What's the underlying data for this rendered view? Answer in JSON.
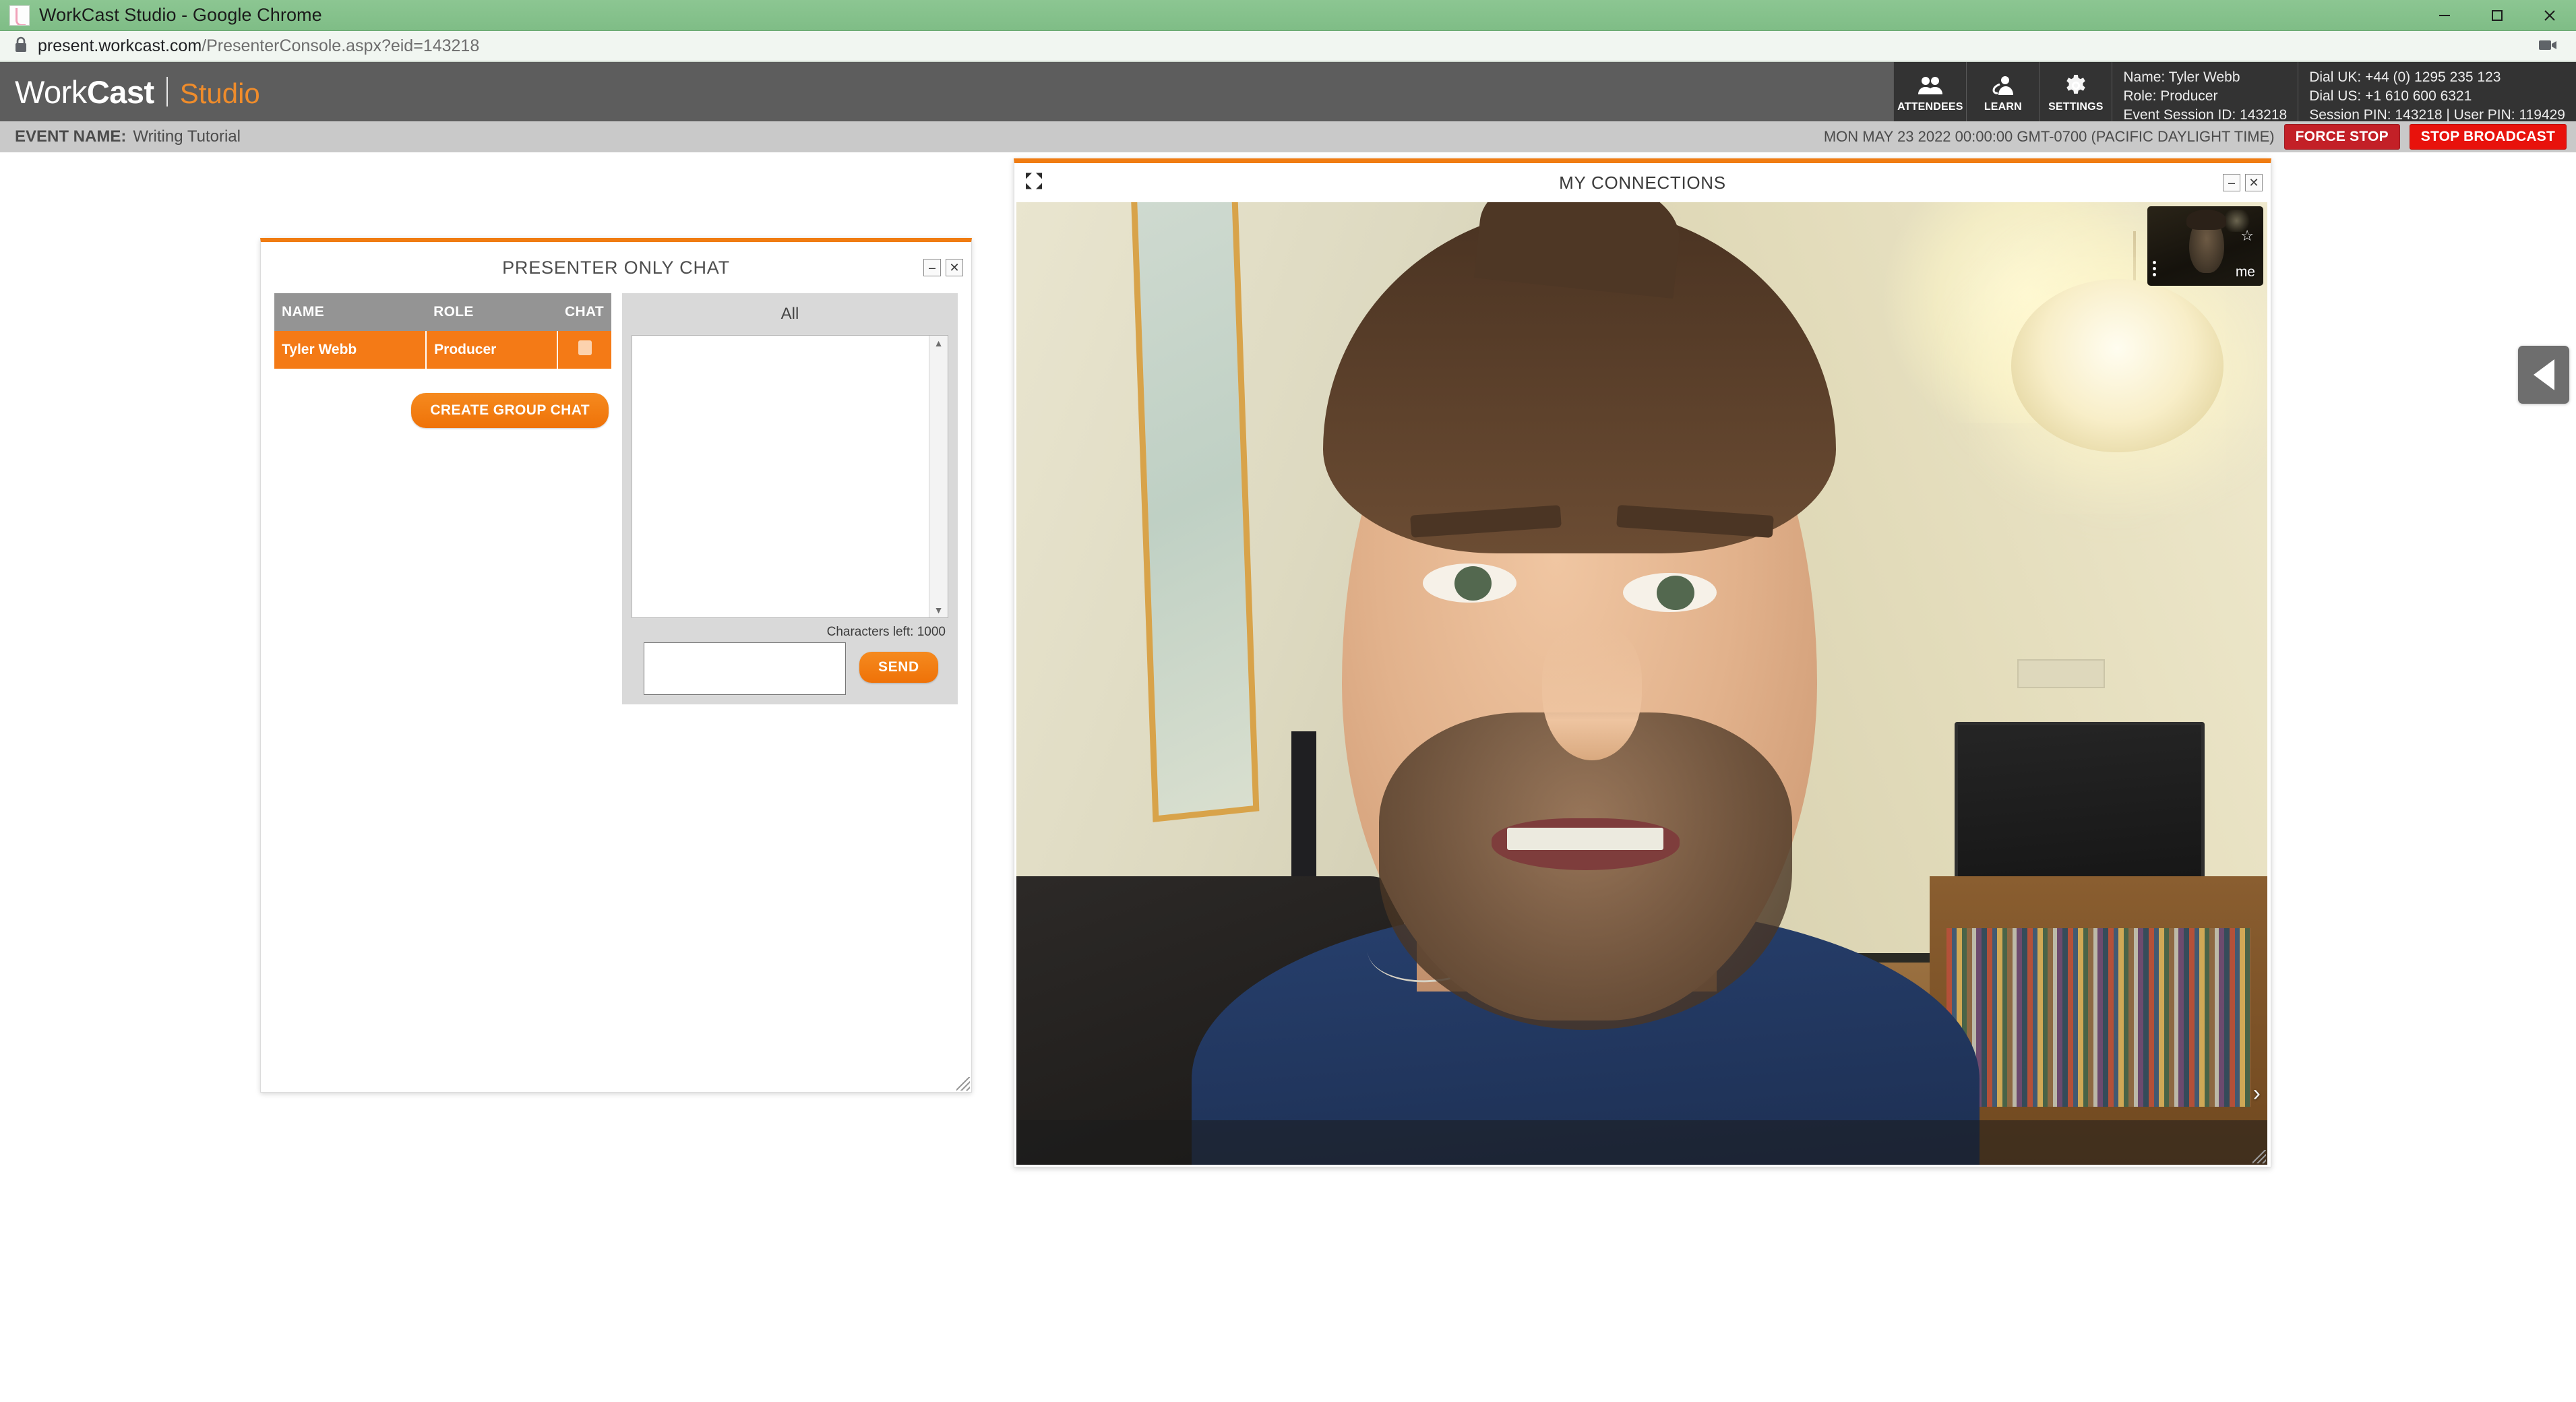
{
  "os_window": {
    "title": "WorkCast Studio - Google Chrome",
    "minimize_label": "Minimize",
    "maximize_label": "Maximize",
    "close_label": "Close"
  },
  "browser": {
    "url_secure": "present.workcast.com",
    "url_path": "/PresenterConsole.aspx?eid=143218",
    "lock_icon": "lock-icon",
    "recording_icon": "camera-recording-icon"
  },
  "app_header": {
    "brand_work": "Work",
    "brand_cast": "Cast",
    "brand_studio": "Studio",
    "nav": [
      {
        "label": "ATTENDEES",
        "icon": "attendees-icon"
      },
      {
        "label": "LEARN",
        "icon": "learn-icon"
      },
      {
        "label": "SETTINGS",
        "icon": "gear-icon"
      }
    ],
    "user_info": [
      "Name: Tyler Webb",
      "Role: Producer",
      "Event Session ID: 143218"
    ],
    "dial_info": [
      "Dial UK: +44 (0) 1295 235 123",
      "Dial US: +1 610 600 6321",
      "Session PIN: 143218 | User PIN: 119429"
    ]
  },
  "event_bar": {
    "label": "EVENT NAME:",
    "name": "Writing Tutorial",
    "datetime": "MON MAY 23 2022 00:00:00 GMT-0700 (PACIFIC DAYLIGHT TIME)",
    "force_stop_label": "FORCE STOP",
    "stop_broadcast_label": "STOP BROADCAST"
  },
  "presenter_chat": {
    "title": "PRESENTER ONLY CHAT",
    "minimize_label": "–",
    "close_label": "✕",
    "table": {
      "headers": [
        "NAME",
        "ROLE",
        "CHAT"
      ],
      "rows": [
        {
          "name": "Tyler Webb",
          "role": "Producer",
          "chat_icon": "chat-bubble-icon"
        }
      ]
    },
    "create_group_chat_label": "CREATE GROUP CHAT",
    "tab_label": "All",
    "messages": [],
    "characters_left": "Characters left: 1000",
    "input_value": "",
    "input_placeholder": "",
    "send_label": "SEND",
    "scroll_up": "▲",
    "scroll_down": "▼"
  },
  "my_connections": {
    "title": "MY CONNECTIONS",
    "expand_icon": "expand-fullscreen-icon",
    "minimize_label": "–",
    "close_label": "✕",
    "self_view_label": "me",
    "star_icon": "star-icon",
    "more_icon": "more-vertical-icon",
    "next_icon": "chevron-right-icon"
  },
  "collapse_tab": {
    "icon": "chevron-left-icon",
    "label": "Collapse panel"
  },
  "colors": {
    "brand_orange": "#f07c12",
    "header_grey": "#5d5d5d",
    "nav_dark": "#333333",
    "event_bar_grey": "#c9c9c9",
    "force_stop_red": "#c32027",
    "stop_broadcast_red": "#e8120c",
    "table_header_grey": "#949494",
    "row_orange": "#f47a16",
    "titlebar_green": "#7fbd86"
  }
}
